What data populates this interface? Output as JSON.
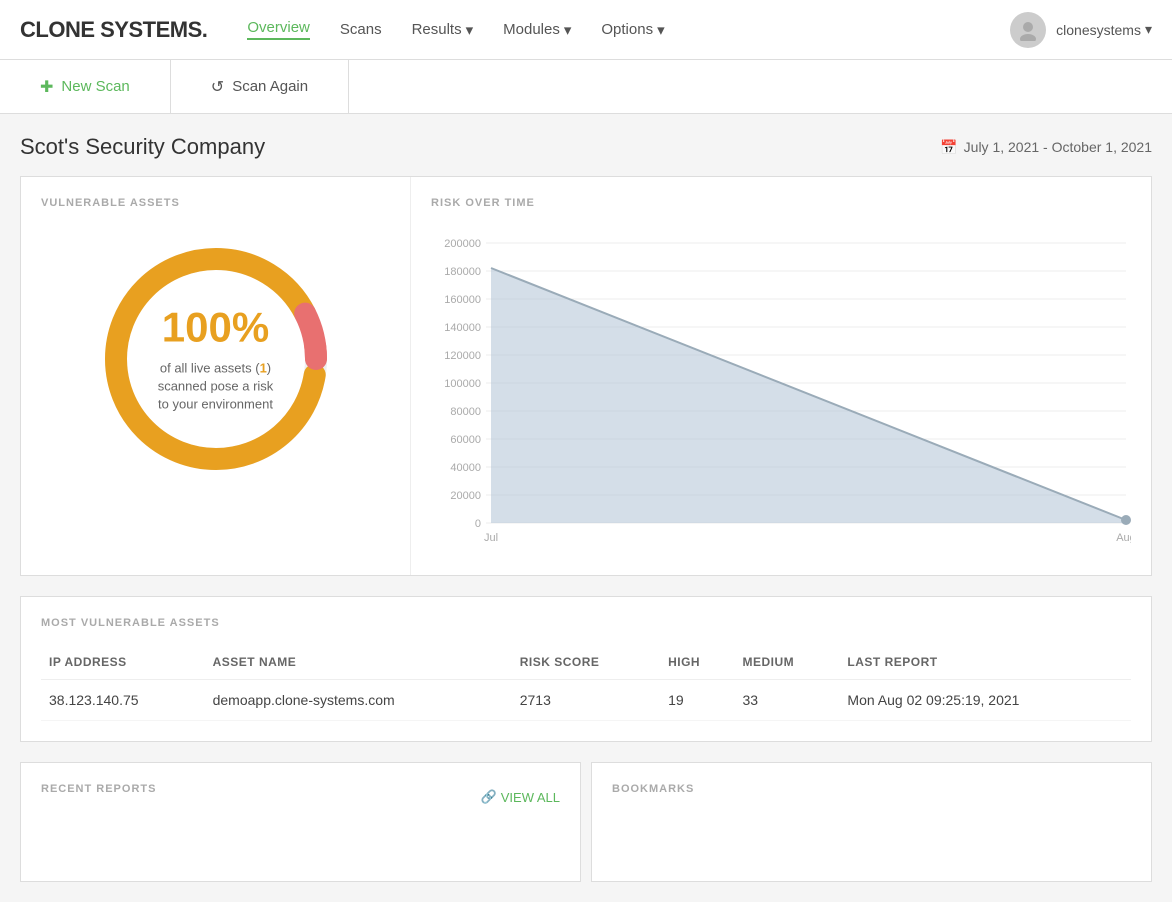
{
  "navbar": {
    "brand": "CLONE SYSTEMS.",
    "links": [
      {
        "label": "Overview",
        "active": true,
        "dropdown": false
      },
      {
        "label": "Scans",
        "active": false,
        "dropdown": false
      },
      {
        "label": "Results",
        "active": false,
        "dropdown": true
      },
      {
        "label": "Modules",
        "active": false,
        "dropdown": true
      },
      {
        "label": "Options",
        "active": false,
        "dropdown": true
      }
    ],
    "username": "clonesystems",
    "username_chevron": "▾"
  },
  "action_bar": {
    "new_scan_label": "New Scan",
    "scan_again_label": "Scan Again"
  },
  "page_header": {
    "title": "Scot's Security Company",
    "date_range": "July 1, 2021 - October 1, 2021"
  },
  "vulnerable_assets": {
    "panel_label": "VULNERABLE ASSETS",
    "percent": "100%",
    "subtitle_pre": "of all live assets (",
    "count": "1",
    "subtitle_post": ") scanned pose a risk to your environment"
  },
  "risk_over_time": {
    "panel_label": "RISK OVER TIME",
    "y_labels": [
      "200000",
      "180000",
      "160000",
      "140000",
      "120000",
      "100000",
      "80000",
      "60000",
      "40000",
      "20000",
      "0"
    ],
    "x_labels": [
      "Jul",
      "Aug"
    ],
    "chart_data": {
      "start_value": 182000,
      "end_value": 2000,
      "max_value": 200000
    }
  },
  "most_vulnerable": {
    "section_label": "MOST VULNERABLE ASSETS",
    "columns": [
      "IP ADDRESS",
      "ASSET NAME",
      "RISK SCORE",
      "HIGH",
      "MEDIUM",
      "LAST REPORT"
    ],
    "rows": [
      {
        "ip": "38.123.140.75",
        "asset_name": "demoapp.clone-systems.com",
        "risk_score": "2713",
        "high": "19",
        "medium": "33",
        "last_report": "Mon Aug 02 09:25:19, 2021"
      }
    ]
  },
  "recent_reports": {
    "section_label": "RECENT REPORTS",
    "view_all_label": "VIEW ALL"
  },
  "bookmarks": {
    "section_label": "BOOKMARKS"
  }
}
